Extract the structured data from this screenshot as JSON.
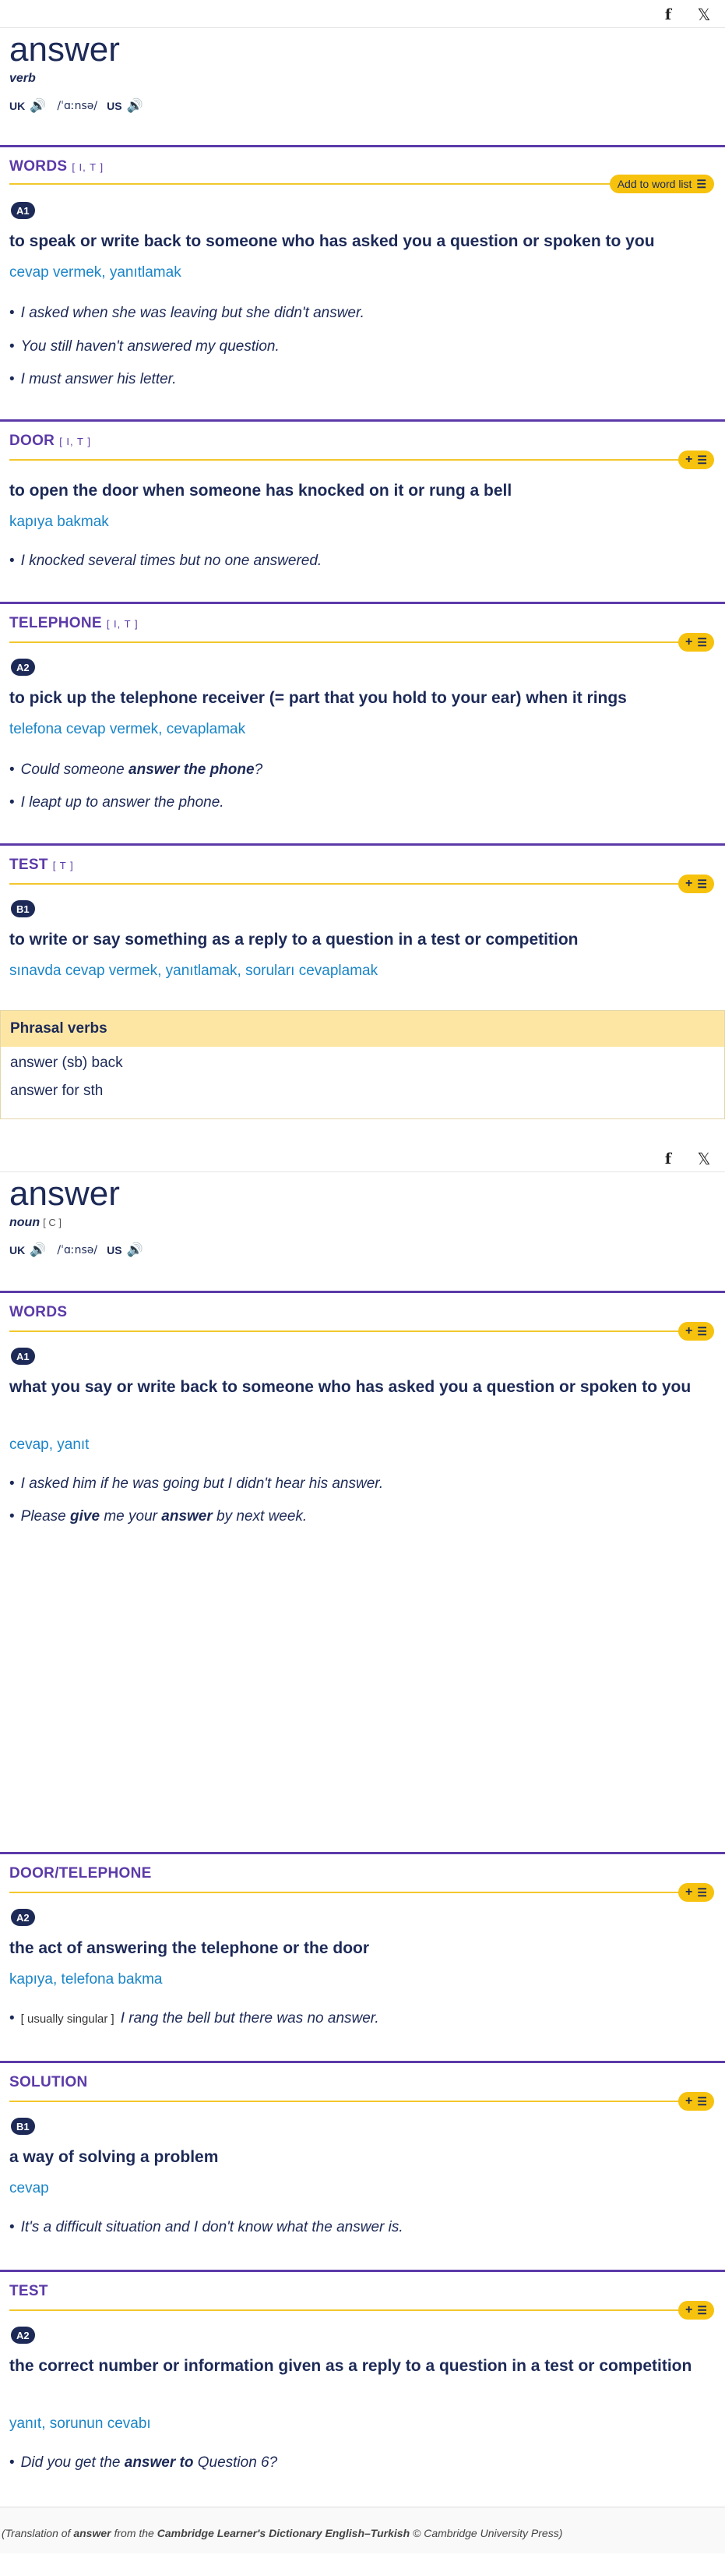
{
  "verb": {
    "headword": "answer",
    "pos": "verb",
    "uk_label": "UK",
    "ipa": "/ˈɑːnsə/",
    "us_label": "US",
    "speaker_icon": "speaker-icon",
    "senses": [
      {
        "title": "WORDS",
        "grammar": "[ I, T ]",
        "add_label": "Add to word list",
        "level": "A1",
        "definition": "to speak or write back to someone who has asked you a question or spoken to you",
        "translation": "cevap vermek, yanıtlamak",
        "examples": [
          "I asked when she was leaving but she didn't answer.",
          "You still haven't answered my question.",
          "I must answer his letter."
        ]
      },
      {
        "title": "DOOR",
        "grammar": "[ I, T ]",
        "definition": "to open the door when someone has knocked on it or rung a bell",
        "translation": "kapıya bakmak",
        "examples": [
          "I knocked several times but no one answered."
        ]
      },
      {
        "title": "TELEPHONE",
        "grammar": "[ I, T ]",
        "level": "A2",
        "definition": "to pick up the telephone receiver (= part that you hold to your ear) when it rings",
        "translation": "telefona cevap vermek, cevaplamak",
        "example1_pre": "Could someone ",
        "example1_bold": "answer the phone",
        "example1_post": "?",
        "example2": "I leapt up to answer the phone."
      },
      {
        "title": "TEST",
        "grammar": "[ T ]",
        "level": "B1",
        "definition": "to write or say something as a reply to a question in a test or competition",
        "translation": "sınavda cevap vermek, yanıtlamak, soruları cevaplamak"
      }
    ],
    "phrasal": {
      "title": "Phrasal verbs",
      "items": [
        "answer (sb) back",
        "answer for sth"
      ]
    }
  },
  "noun": {
    "headword": "answer",
    "pos": "noun",
    "grammar": "[ C ]",
    "uk_label": "UK",
    "ipa": "/ˈɑːnsə/",
    "us_label": "US",
    "senses": [
      {
        "title": "WORDS",
        "level": "A1",
        "definition": "what you say or write back to someone who has asked you a question or spoken to you",
        "translation": "cevap, yanıt",
        "example1": "I asked him if he was going but I didn't hear his answer.",
        "example2_a": "Please ",
        "example2_b": "give",
        "example2_c": " me your ",
        "example2_d": "answer",
        "example2_e": " by next week."
      },
      {
        "title": "DOOR/TELEPHONE",
        "level": "A2",
        "definition": "the act of answering the telephone or the door",
        "translation": "kapıya, telefona bakma",
        "example_grammar": "[ usually singular ]",
        "example": "I rang the bell but there was no answer."
      },
      {
        "title": "SOLUTION",
        "level": "B1",
        "definition": "a way of solving a problem",
        "translation": "cevap",
        "example": "It's a difficult situation and I don't know what the answer is."
      },
      {
        "title": "TEST",
        "level": "A2",
        "definition": "the correct number or information given as a reply to a question in a test or competition",
        "translation": "yanıt, sorunun cevabı",
        "example_a": "Did you get the ",
        "example_b": "answer to",
        "example_c": " Question 6?"
      }
    ]
  },
  "footer": {
    "pre": "(Translation of ",
    "word": "answer",
    "mid": " from the ",
    "source": "Cambridge Learner's Dictionary English–Turkish",
    "post": " © Cambridge University Press)"
  },
  "icons": {
    "facebook": "f",
    "x": "𝕏",
    "speaker": "🔊",
    "plus": "+",
    "list": "☰"
  },
  "colors": {
    "navy": "#1d2a57",
    "purple": "#5b3aa8",
    "yellow": "#f6c20d",
    "blue": "#1a85c7"
  }
}
